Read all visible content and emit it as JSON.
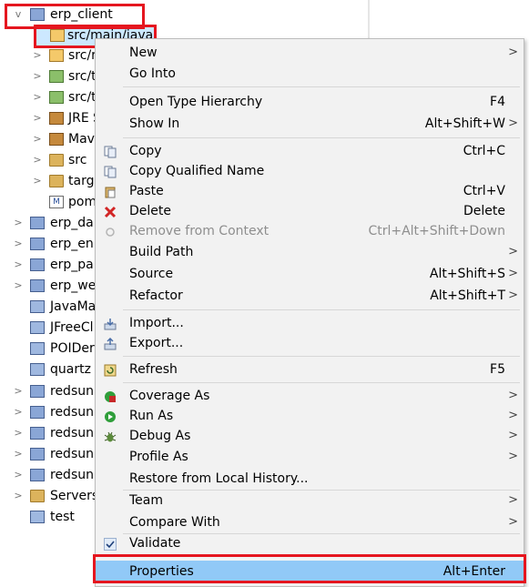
{
  "tree": {
    "items": [
      {
        "label": "erp_client",
        "chevron": "v"
      },
      {
        "label": "src/main/java",
        "chevron": ""
      },
      {
        "label": "src/r",
        "chevron": ">"
      },
      {
        "label": "src/t",
        "chevron": ">"
      },
      {
        "label": "src/t",
        "chevron": ">"
      },
      {
        "label": "JRE S",
        "chevron": ">"
      },
      {
        "label": "Mav",
        "chevron": ">"
      },
      {
        "label": "src",
        "chevron": ">"
      },
      {
        "label": "targ",
        "chevron": ">"
      },
      {
        "label": "pom",
        "chevron": ""
      },
      {
        "label": "erp_da",
        "chevron": ">"
      },
      {
        "label": "erp_en",
        "chevron": ">"
      },
      {
        "label": "erp_pa",
        "chevron": ">"
      },
      {
        "label": "erp_we",
        "chevron": ">"
      },
      {
        "label": "JavaMa",
        "chevron": ""
      },
      {
        "label": "JFreeCl",
        "chevron": ""
      },
      {
        "label": "POIDer",
        "chevron": ""
      },
      {
        "label": "quartz",
        "chevron": ""
      },
      {
        "label": "redsun",
        "chevron": ">"
      },
      {
        "label": "redsun",
        "chevron": ">"
      },
      {
        "label": "redsun",
        "chevron": ">"
      },
      {
        "label": "redsun",
        "chevron": ">"
      },
      {
        "label": "redsun",
        "chevron": ">"
      },
      {
        "label": "Servers",
        "chevron": ">"
      },
      {
        "label": "test",
        "chevron": ""
      }
    ]
  },
  "menu": {
    "items": [
      {
        "label": "New",
        "shortcut": "",
        "submenu": true
      },
      {
        "label": "Go Into",
        "shortcut": "",
        "submenu": false
      },
      {
        "label": "Open Type Hierarchy",
        "shortcut": "F4",
        "submenu": false
      },
      {
        "label": "Show In",
        "shortcut": "Alt+Shift+W",
        "submenu": true
      },
      {
        "label": "Copy",
        "shortcut": "Ctrl+C",
        "submenu": false
      },
      {
        "label": "Copy Qualified Name",
        "shortcut": "",
        "submenu": false
      },
      {
        "label": "Paste",
        "shortcut": "Ctrl+V",
        "submenu": false
      },
      {
        "label": "Delete",
        "shortcut": "Delete",
        "submenu": false
      },
      {
        "label": "Remove from Context",
        "shortcut": "Ctrl+Alt+Shift+Down",
        "submenu": false
      },
      {
        "label": "Build Path",
        "shortcut": "",
        "submenu": true
      },
      {
        "label": "Source",
        "shortcut": "Alt+Shift+S",
        "submenu": true
      },
      {
        "label": "Refactor",
        "shortcut": "Alt+Shift+T",
        "submenu": true
      },
      {
        "label": "Import...",
        "shortcut": "",
        "submenu": false
      },
      {
        "label": "Export...",
        "shortcut": "",
        "submenu": false
      },
      {
        "label": "Refresh",
        "shortcut": "F5",
        "submenu": false
      },
      {
        "label": "Coverage As",
        "shortcut": "",
        "submenu": true
      },
      {
        "label": "Run As",
        "shortcut": "",
        "submenu": true
      },
      {
        "label": "Debug As",
        "shortcut": "",
        "submenu": true
      },
      {
        "label": "Profile As",
        "shortcut": "",
        "submenu": true
      },
      {
        "label": "Restore from Local History...",
        "shortcut": "",
        "submenu": false
      },
      {
        "label": "Team",
        "shortcut": "",
        "submenu": true
      },
      {
        "label": "Compare With",
        "shortcut": "",
        "submenu": true
      },
      {
        "label": "Validate",
        "shortcut": "",
        "submenu": false
      },
      {
        "label": "Properties",
        "shortcut": "Alt+Enter",
        "submenu": false
      }
    ],
    "submenu_arrow": ">"
  },
  "colors": {
    "annotation": "#e5161f",
    "highlight": "#91c9f7",
    "menu_bg": "#f2f2f2"
  }
}
